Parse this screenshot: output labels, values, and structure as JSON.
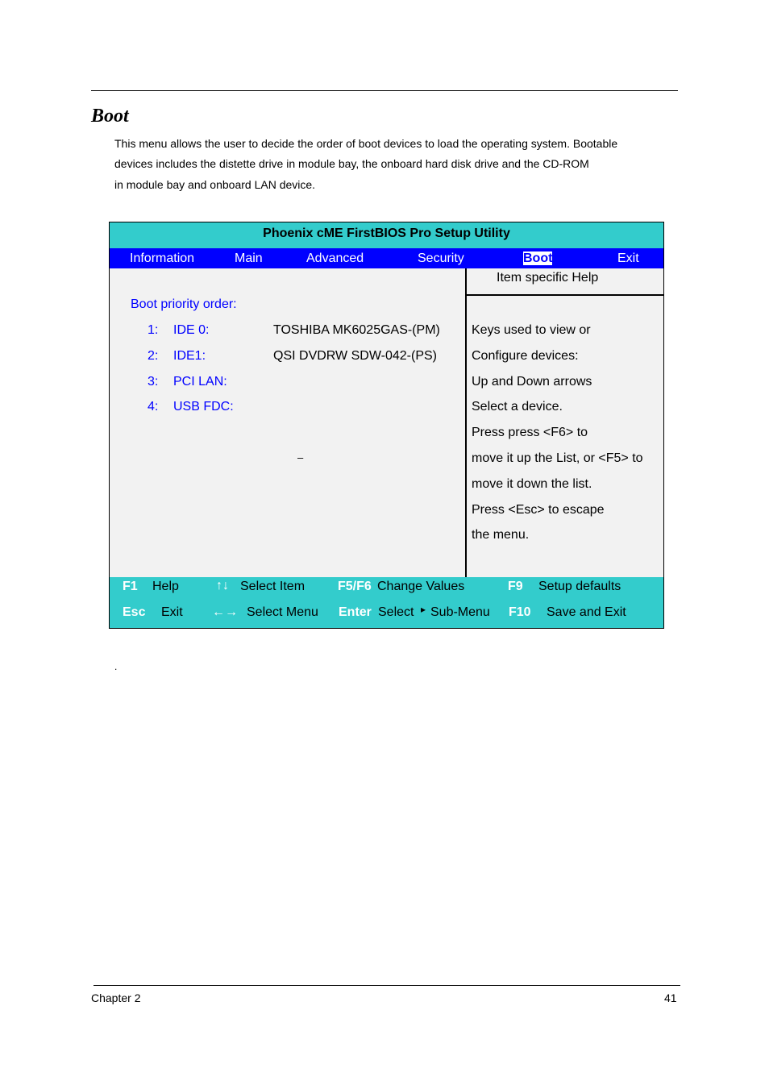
{
  "heading": "Boot",
  "intro": [
    "This menu allows the user to decide the order of boot devices to load the operating system. Bootable",
    "devices includes the distette drive in module bay, the onboard hard disk drive and the CD-ROM",
    "in module bay and onboard LAN device."
  ],
  "bios": {
    "title": "Phoenix cME FirstBIOS Pro Setup Utility",
    "menu": [
      "Information",
      "Main",
      "Advanced",
      "Security",
      "Boot",
      "Exit"
    ],
    "active_menu": "Boot",
    "boot_priority_label": "Boot priority order:",
    "devices": [
      {
        "num": "1:",
        "name": "IDE 0:",
        "value": "TOSHIBA MK6025GAS-(PM)"
      },
      {
        "num": "2:",
        "name": "IDE1:",
        "value": "QSI DVDRW SDW-042-(PS)"
      },
      {
        "num": "3:",
        "name": "PCI LAN:",
        "value": ""
      },
      {
        "num": "4:",
        "name": "USB FDC:",
        "value": ""
      }
    ],
    "dash": "–",
    "help_title": "Item specific Help",
    "help_lines": [
      "Keys used to view or",
      "Configure devices:",
      "Up and Down arrows",
      "Select a device.",
      "Press press <F6> to",
      "move it up the List, or <F5> to",
      "move it down the list.",
      "Press <Esc> to escape",
      "the menu."
    ],
    "footer": {
      "f1": "F1",
      "help": "Help",
      "updown": "↑↓",
      "select_item": "Select Item",
      "f5f6": "F5/F6",
      "change_values": "Change Values",
      "f9": "F9",
      "setup_defaults": "Setup defaults",
      "esc": "Esc",
      "exit": "Exit",
      "leftright": "←→",
      "select_menu": "Select Menu",
      "enter": "Enter",
      "select_sub": "Select",
      "tri": "▸",
      "sub_menu": "Sub-Menu",
      "f10": "F10",
      "save_exit": "Save and Exit"
    },
    "colors": {
      "title_bg": "#33cccc",
      "menu_bg": "#0000ff",
      "body_bg": "#f2f2f2"
    }
  },
  "dot": ".",
  "footer": {
    "chapter": "Chapter 2",
    "page": "41"
  }
}
